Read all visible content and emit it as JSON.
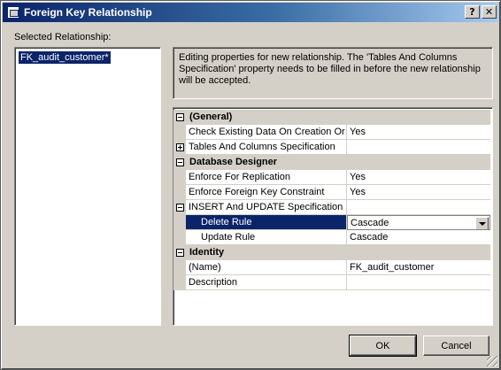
{
  "window": {
    "title": "Foreign Key Relationship",
    "help_label": "?",
    "close_label": "✕"
  },
  "selected_relationship": {
    "label": "Selected Relationship:",
    "items": [
      "FK_audit_customer*"
    ]
  },
  "info_text": "Editing properties for new relationship.  The 'Tables And Columns Specification' property needs to be filled in before the new relationship will be accepted.",
  "properties": {
    "general": {
      "title": "(General)",
      "check_existing": {
        "name": "Check Existing Data On Creation Or R",
        "value": "Yes"
      },
      "tables_columns": {
        "name": "Tables And Columns Specification",
        "value": ""
      }
    },
    "database_designer": {
      "title": "Database Designer",
      "enforce_replication": {
        "name": "Enforce For Replication",
        "value": "Yes"
      },
      "enforce_fk": {
        "name": "Enforce Foreign Key Constraint",
        "value": "Yes"
      },
      "insert_update": {
        "name": "INSERT And UPDATE Specification",
        "value": ""
      },
      "delete_rule": {
        "name": "Delete Rule",
        "value": "Cascade"
      },
      "update_rule": {
        "name": "Update Rule",
        "value": "Cascade"
      }
    },
    "identity": {
      "title": "Identity",
      "name": {
        "name": "(Name)",
        "value": "FK_audit_customer"
      },
      "description": {
        "name": "Description",
        "value": ""
      }
    }
  },
  "buttons": {
    "ok": "OK",
    "cancel": "Cancel"
  },
  "colors": {
    "title_start": "#0a246a",
    "title_end": "#a6caf0",
    "selection": "#0a246a",
    "face": "#d4d0c8"
  }
}
